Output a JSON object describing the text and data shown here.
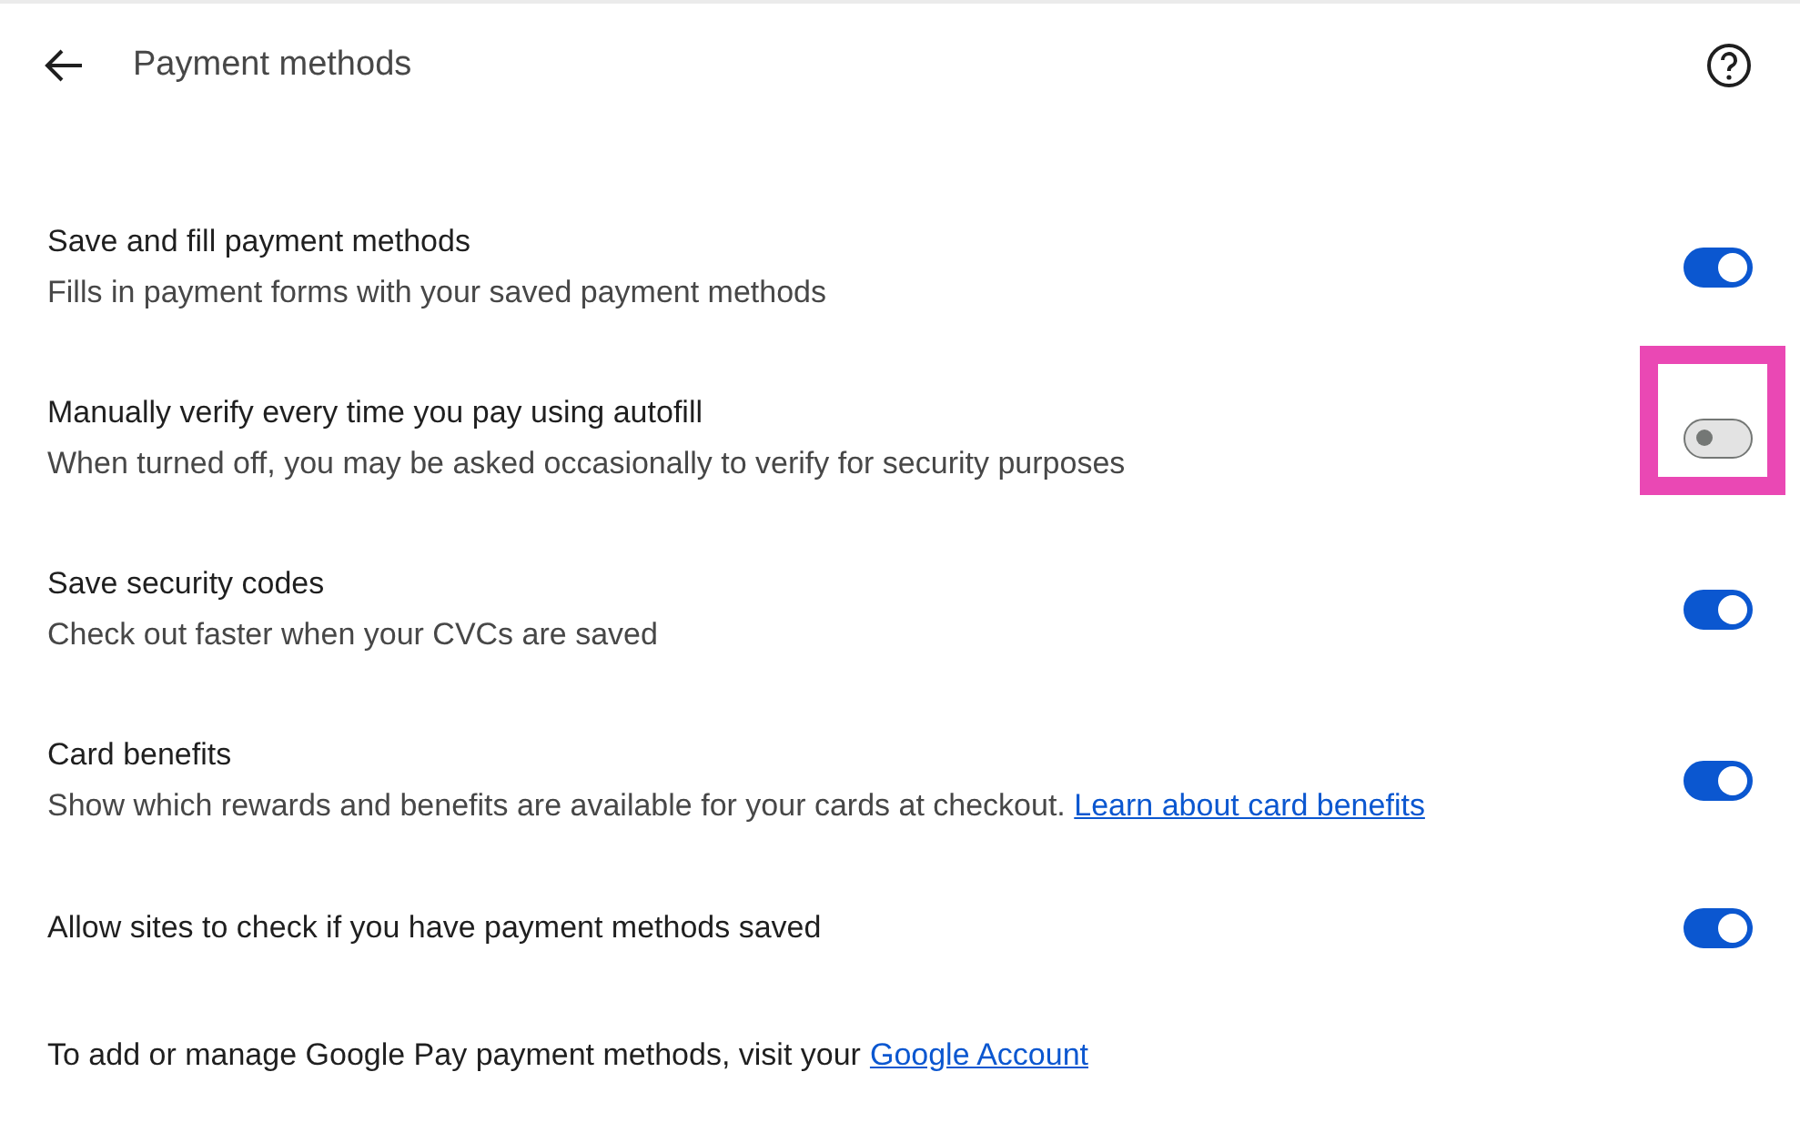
{
  "header": {
    "title": "Payment methods"
  },
  "settings": [
    {
      "title": "Save and fill payment methods",
      "description": "Fills in payment forms with your saved payment methods",
      "on": true,
      "highlighted": false
    },
    {
      "title": "Manually verify every time you pay using autofill",
      "description": "When turned off, you may be asked occasionally to verify for security purposes",
      "on": false,
      "highlighted": true
    },
    {
      "title": "Save security codes",
      "description": "Check out faster when your CVCs are saved",
      "on": true,
      "highlighted": false
    },
    {
      "title": "Card benefits",
      "description": "Show which rewards and benefits are available for your cards at checkout.",
      "link": "Learn about card benefits",
      "on": true,
      "highlighted": false
    },
    {
      "title": "Allow sites to check if you have payment methods saved",
      "on": true,
      "highlighted": false
    }
  ],
  "footer": {
    "text": "To add or manage Google Pay payment methods, visit your",
    "link": "Google Account"
  }
}
